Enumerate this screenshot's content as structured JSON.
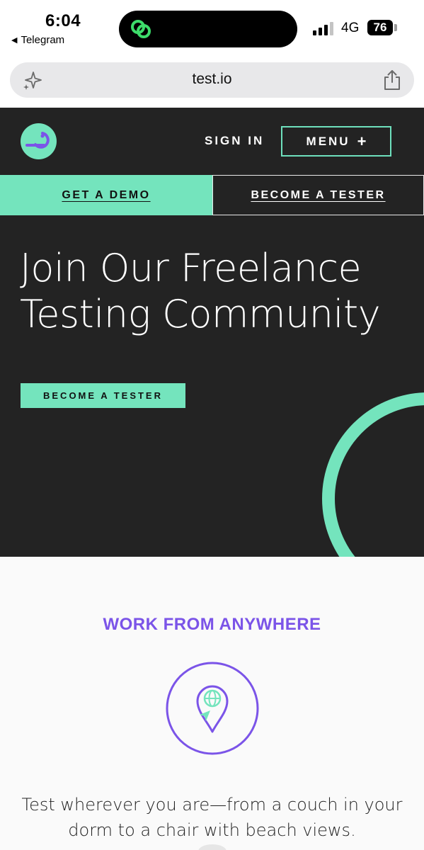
{
  "status_bar": {
    "time": "6:04",
    "back_app": "Telegram",
    "network": "4G",
    "battery": "76"
  },
  "browser": {
    "url": "test.io"
  },
  "nav": {
    "sign_in": "SIGN IN",
    "menu": "MENU",
    "menu_icon": "+"
  },
  "cta": {
    "demo": "GET A DEMO",
    "tester": "BECOME A TESTER"
  },
  "hero": {
    "title": "Join Our Freelance Testing Community",
    "button": "BECOME A TESTER"
  },
  "feature": {
    "heading": "WORK FROM ANYWHERE",
    "icon": "location-globe-icon",
    "text": "Test wherever you are—from a couch in your dorm to a chair with beach views."
  },
  "colors": {
    "brand_mint": "#74e4bd",
    "brand_purple": "#7b54e8",
    "dark_bg": "#232323"
  }
}
